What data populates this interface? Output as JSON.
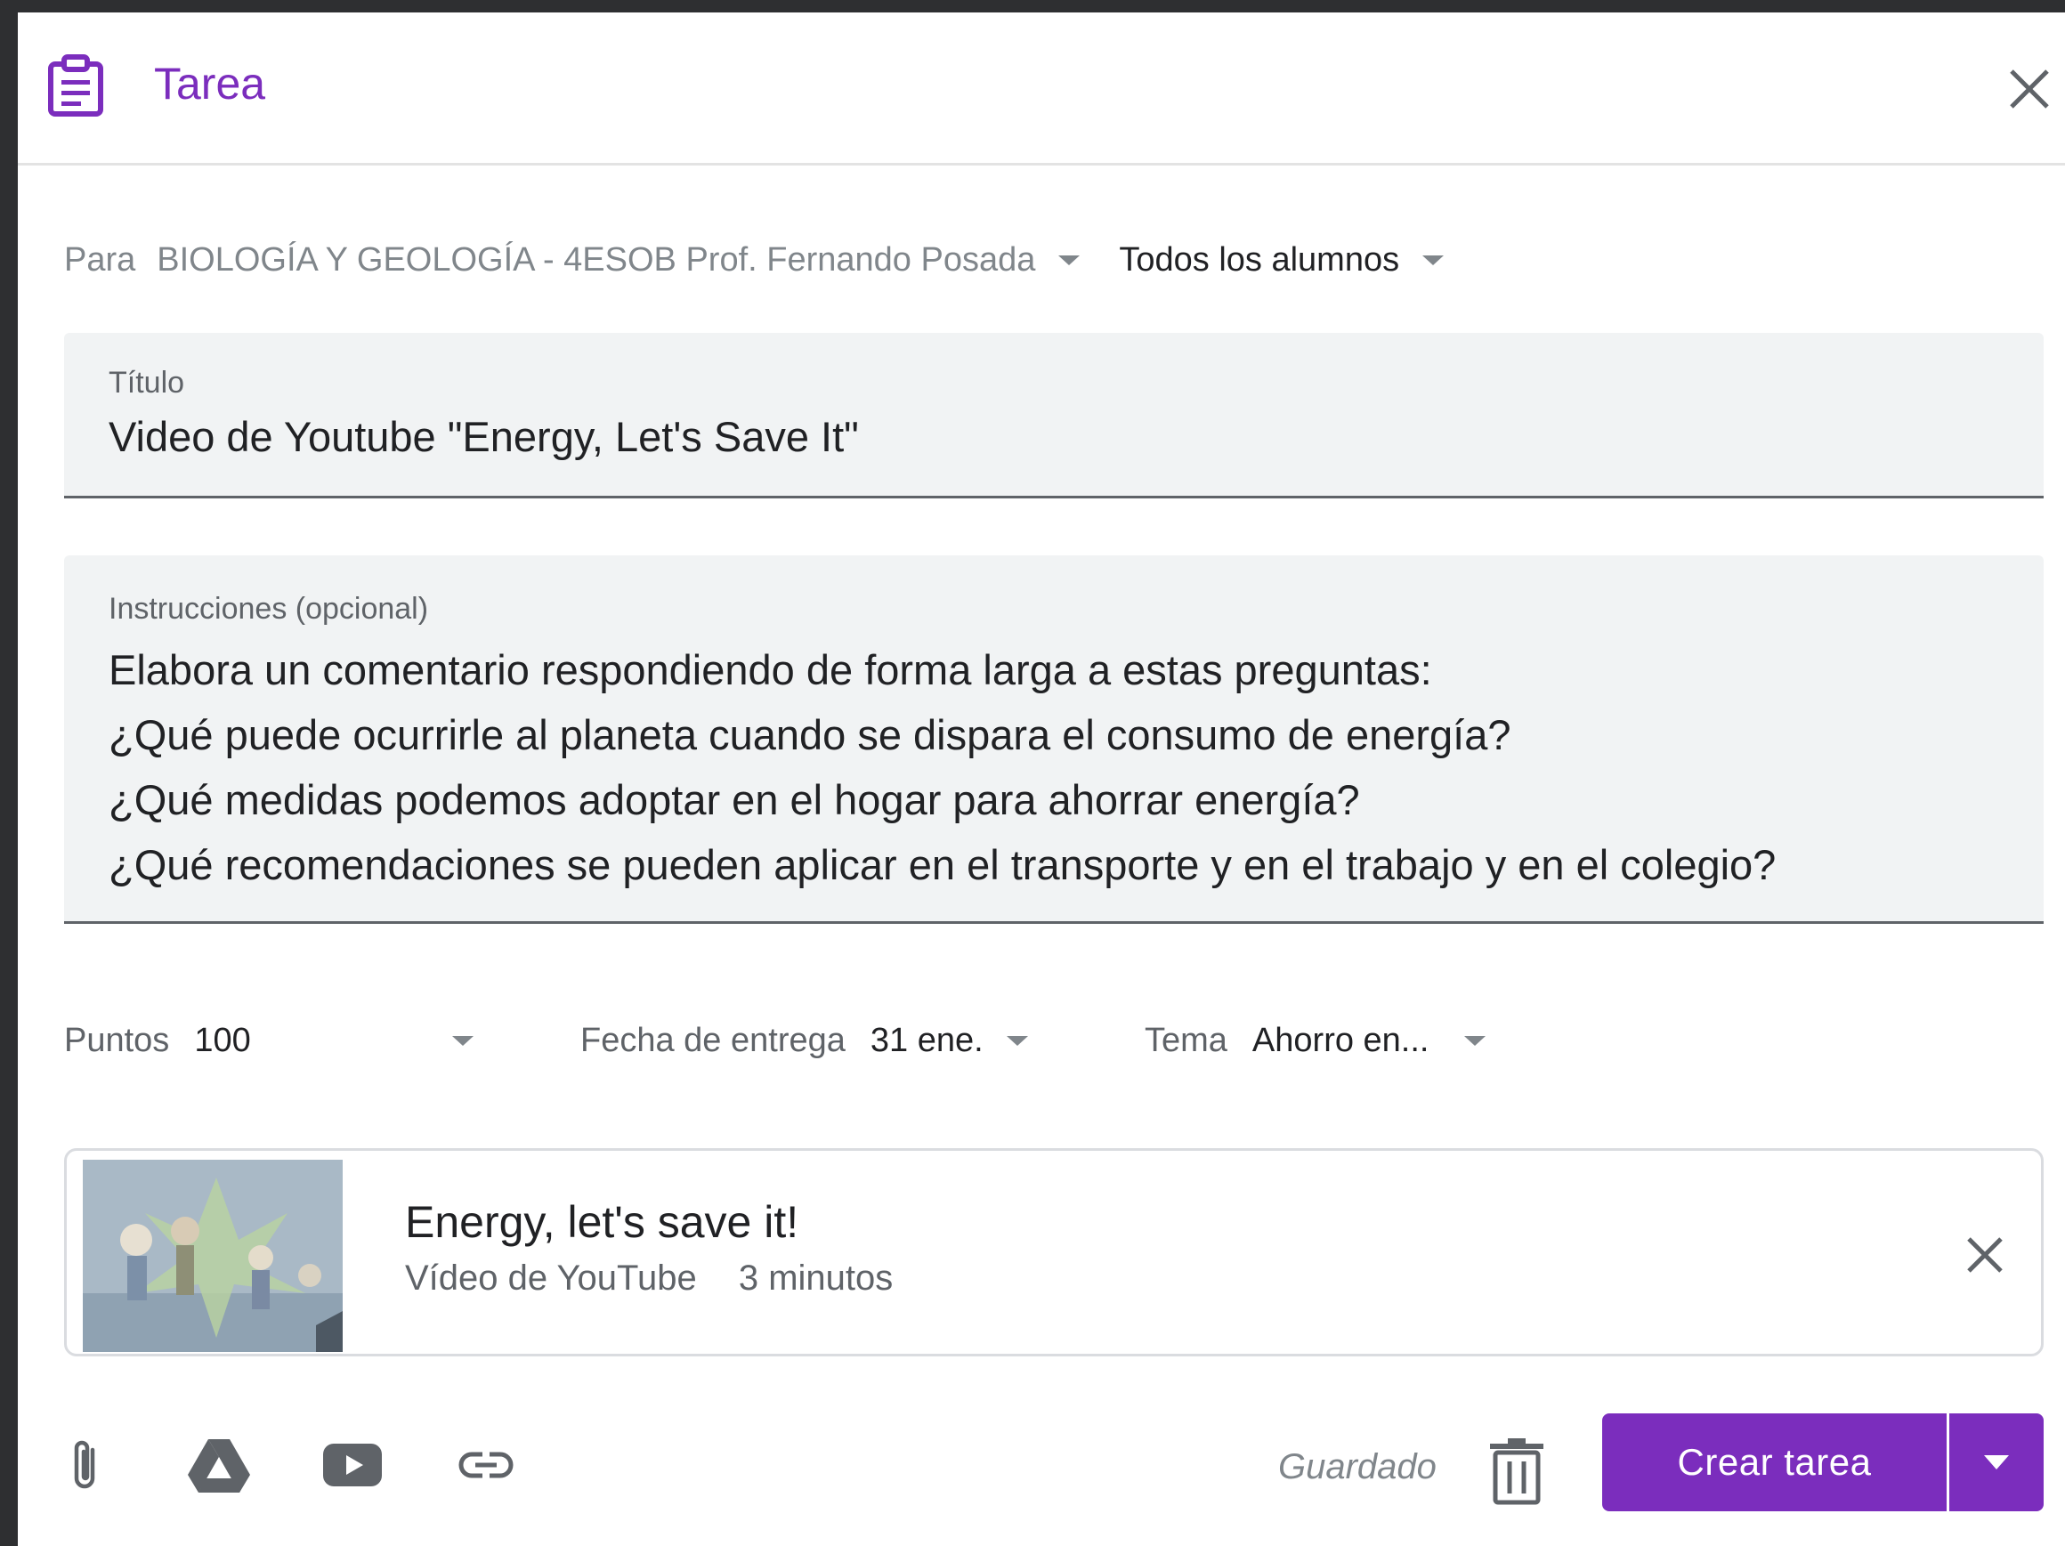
{
  "header": {
    "title": "Tarea",
    "icon": "assignment-icon",
    "accent_color": "#7b2dbd"
  },
  "audience": {
    "para_label": "Para",
    "course": "BIOLOGÍA Y GEOLOGÍA - 4ESOB Prof. Fernando Posada",
    "students": "Todos los alumnos"
  },
  "title_field": {
    "label": "Título",
    "value": "Video de Youtube \"Energy, Let's Save It\""
  },
  "instructions_field": {
    "label": "Instrucciones (opcional)",
    "lines": [
      "Elabora un comentario respondiendo de forma larga a estas preguntas:",
      "¿Qué puede ocurrirle al planeta cuando se dispara el consumo de energía?",
      "¿Qué medidas podemos adoptar en el hogar para ahorrar energía?",
      "¿Qué recomendaciones se pueden aplicar en el transporte y en el trabajo y en el colegio?"
    ]
  },
  "settings": {
    "points_label": "Puntos",
    "points_value": "100",
    "due_label": "Fecha de entrega",
    "due_value": "31 ene.",
    "topic_label": "Tema",
    "topic_value": "Ahorro en..."
  },
  "attachment": {
    "title": "Energy, let's save it!",
    "type": "Vídeo de YouTube",
    "duration": "3 minutos"
  },
  "footer": {
    "saved_status": "Guardado",
    "create_label": "Crear tarea",
    "icons": [
      "attach-file-icon",
      "google-drive-icon",
      "youtube-icon",
      "link-icon",
      "trash-icon"
    ]
  }
}
